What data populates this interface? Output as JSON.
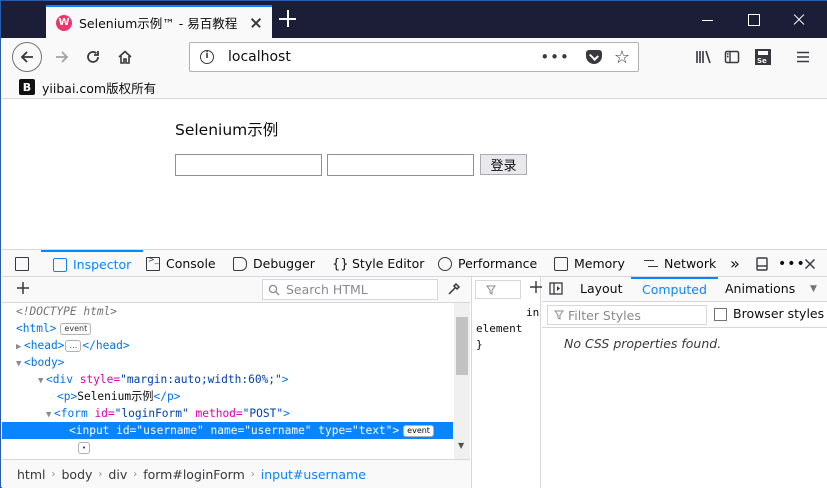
{
  "browser": {
    "tab_title": "Selenium示例™ - 易百教程",
    "tab_favicon_letter": "W",
    "url": "localhost",
    "url_more": "•••",
    "url_star": "☆",
    "bookmark_icon_letter": "B",
    "bookmark_label": "yiibai.com版权所有"
  },
  "page": {
    "heading": "Selenium示例",
    "submit_label": "登录"
  },
  "devtools": {
    "tabs": [
      "Inspector",
      "Console",
      "Debugger",
      "Style Editor",
      "Performance",
      "Memory",
      "Network"
    ],
    "more_tabs": "»",
    "search_placeholder": "Search HTML",
    "markup": {
      "doctype": "<!DOCTYPE html>",
      "html_open": "<html>",
      "head_open": "<head>",
      "head_ellipsis": "…",
      "head_close": "</head>",
      "body_open": "<body>",
      "div_tag": "<div",
      "div_style_attr": "style=",
      "div_style_val": "\"margin:auto;width:60%;\"",
      "div_end": ">",
      "p_open": "<p>",
      "p_text": "Selenium示例",
      "p_close": "</p>",
      "form_tag": "<form",
      "form_id_attr": "id=",
      "form_id_val": "\"loginForm\"",
      "form_method_attr": "method=",
      "form_method_val": "\"POST\"",
      "form_end": ">",
      "input_tag": "<input",
      "input_id_attr": "id=",
      "input_id_val": "\"username\"",
      "input_name_attr": "name=",
      "input_name_val": "\"username\"",
      "input_type_attr": "type=",
      "input_type_val": "\"text\"",
      "input_end": ">",
      "event_badge": "event"
    },
    "breadcrumbs": [
      "html",
      "body",
      "div",
      "form#loginForm",
      "input#username"
    ],
    "mid_pane": {
      "line1": "in",
      "line2": "element",
      "line3": "}"
    },
    "right_tabs": [
      "Layout",
      "Computed",
      "Animations"
    ],
    "filter_placeholder": "Filter Styles",
    "browser_styles_label": "Browser styles",
    "no_css_message": "No CSS properties found."
  }
}
